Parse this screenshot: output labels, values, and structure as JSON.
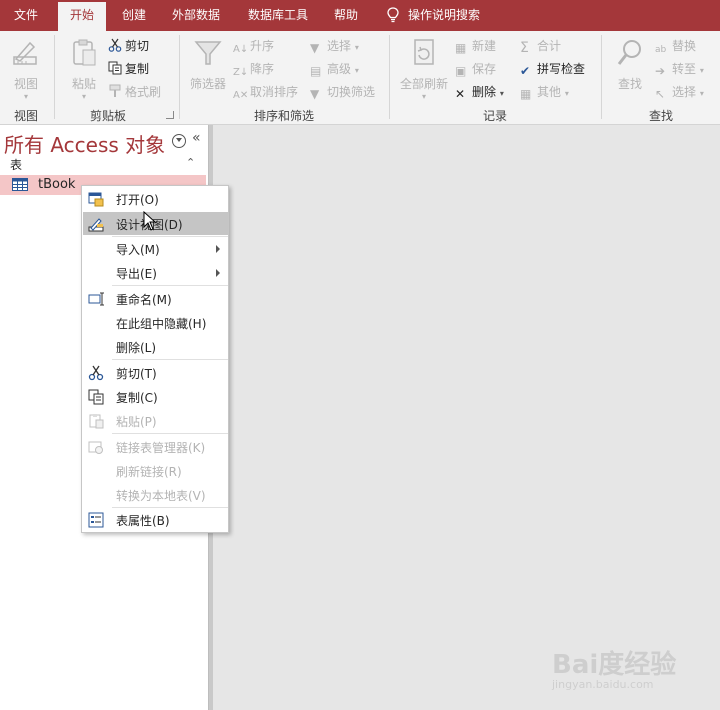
{
  "tabs": [
    "文件",
    "开始",
    "创建",
    "外部数据",
    "数据库工具",
    "帮助"
  ],
  "tell_me": "操作说明搜索",
  "ribbon": {
    "view": {
      "button": "视图",
      "group": "视图"
    },
    "clipboard": {
      "paste": "粘贴",
      "cut": "剪切",
      "copy": "复制",
      "format_painter": "格式刷",
      "group": "剪贴板"
    },
    "sort_filter": {
      "filter": "筛选器",
      "ascending": "升序",
      "descending": "降序",
      "remove_sort": "取消排序",
      "selection": "选择",
      "advanced": "高级",
      "toggle_filter": "切换筛选",
      "group": "排序和筛选"
    },
    "records": {
      "refresh_all": "全部刷新",
      "new": "新建",
      "save": "保存",
      "delete": "删除",
      "totals": "合计",
      "spelling": "拼写检查",
      "more": "其他",
      "group": "记录"
    },
    "find": {
      "find": "查找",
      "replace": "替换",
      "goto": "转至",
      "select": "选择",
      "group": "查找"
    }
  },
  "nav": {
    "title": "所有 Access 对象",
    "collapse_glyph": "«",
    "section": "表",
    "section_toggle": "⌃",
    "items": [
      {
        "name": "tBook"
      }
    ]
  },
  "context_menu": [
    {
      "label": "打开(O)",
      "icon": "open-icon",
      "enabled": true,
      "submenu": false
    },
    {
      "label": "设计视图(D)",
      "icon": "design-view-icon",
      "enabled": true,
      "submenu": false,
      "highlighted": true
    },
    {
      "label": "导入(M)",
      "icon": "",
      "enabled": true,
      "submenu": true
    },
    {
      "label": "导出(E)",
      "icon": "",
      "enabled": true,
      "submenu": true
    },
    {
      "label": "重命名(M)",
      "icon": "rename-icon",
      "enabled": true,
      "submenu": false
    },
    {
      "label": "在此组中隐藏(H)",
      "icon": "",
      "enabled": true,
      "submenu": false
    },
    {
      "label": "删除(L)",
      "icon": "",
      "enabled": true,
      "submenu": false
    },
    {
      "label": "剪切(T)",
      "icon": "scissors-icon",
      "enabled": true,
      "submenu": false
    },
    {
      "label": "复制(C)",
      "icon": "copy-icon",
      "enabled": true,
      "submenu": false
    },
    {
      "label": "粘贴(P)",
      "icon": "paste-icon",
      "enabled": false,
      "submenu": false
    },
    {
      "label": "链接表管理器(K)",
      "icon": "link-manager-icon",
      "enabled": false,
      "submenu": false
    },
    {
      "label": "刷新链接(R)",
      "icon": "",
      "enabled": false,
      "submenu": false
    },
    {
      "label": "转换为本地表(V)",
      "icon": "",
      "enabled": false,
      "submenu": false
    },
    {
      "label": "表属性(B)",
      "icon": "table-properties-icon",
      "enabled": true,
      "submenu": false
    }
  ],
  "watermark": {
    "text": "Bai度经验",
    "sub": "jingyan.baidu.com"
  },
  "colors": {
    "accent": "#a4373a",
    "selection": "#f4c6c7",
    "menu_highlight": "#c5c5c5"
  }
}
